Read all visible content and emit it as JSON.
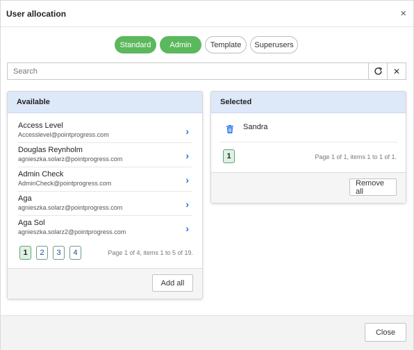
{
  "dialog": {
    "title": "User allocation",
    "close_glyph": "×"
  },
  "filters": [
    {
      "label": "Standard",
      "active": true
    },
    {
      "label": "Admin",
      "active": true
    },
    {
      "label": "Template",
      "active": false
    },
    {
      "label": "Superusers",
      "active": false
    }
  ],
  "search": {
    "placeholder": "Search",
    "value": "",
    "refresh_icon": "refresh-icon",
    "clear_icon": "clear-icon",
    "clear_glyph": "✕"
  },
  "available": {
    "heading": "Available",
    "items": [
      {
        "name": "Access Level",
        "email": "Accesslevel@pointprogress.com"
      },
      {
        "name": "Douglas Reynholm",
        "email": "agnieszka.solarz@pointprogress.com"
      },
      {
        "name": "Admin Check",
        "email": "AdminCheck@pointprogress.com"
      },
      {
        "name": "Aga",
        "email": "agnieszka.solarz@pointprogress.com"
      },
      {
        "name": "Aga Sol",
        "email": "agnieszka.solarz2@pointprogress.com"
      }
    ],
    "arrow_glyph": "›",
    "pages": [
      "1",
      "2",
      "3",
      "4"
    ],
    "current_page": "1",
    "pager_info": "Page 1 of 4, items 1 to 5 of 19.",
    "add_all_label": "Add all"
  },
  "selected": {
    "heading": "Selected",
    "items": [
      {
        "name": "Sandra"
      }
    ],
    "pages": [
      "1"
    ],
    "current_page": "1",
    "pager_info": "Page 1 of 1, items 1 to 1 of 1.",
    "remove_all_label": "Remove all"
  },
  "footer": {
    "close_label": "Close"
  },
  "colors": {
    "active_chip": "#5cb85c",
    "panel_header": "#dde8f9",
    "link_blue": "#1a73e8"
  }
}
